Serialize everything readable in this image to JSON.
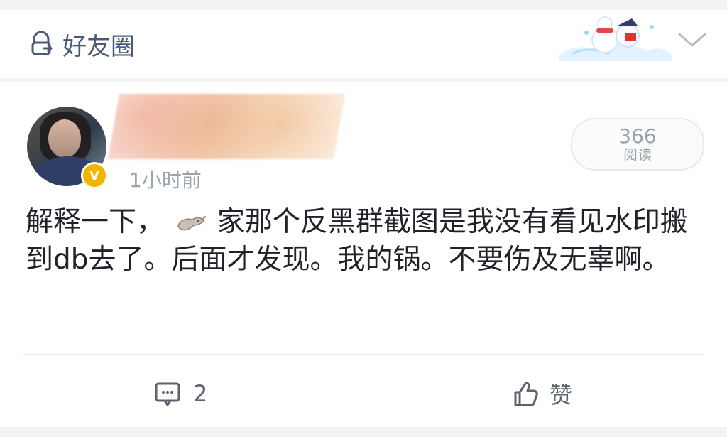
{
  "group": {
    "label": "好友圈"
  },
  "post": {
    "time": "1小时前",
    "read_count": "366",
    "read_label": "阅读",
    "text_1": "解释一下，",
    "text_2": "家那个反黑群截图是我没有看见水印搬到db去了。后面才发现。我的锅。不要伤及无辜啊。",
    "comment_count": "2",
    "like_label": "赞"
  },
  "colors": {
    "accent_text": "#4a5a73",
    "badge": "#f3b400"
  },
  "icons": {
    "group_lock": "lock-group-icon",
    "chevron": "chevron-down-icon",
    "comment": "comment-icon",
    "like": "thumbs-up-icon",
    "verified": "verified-badge-icon"
  }
}
